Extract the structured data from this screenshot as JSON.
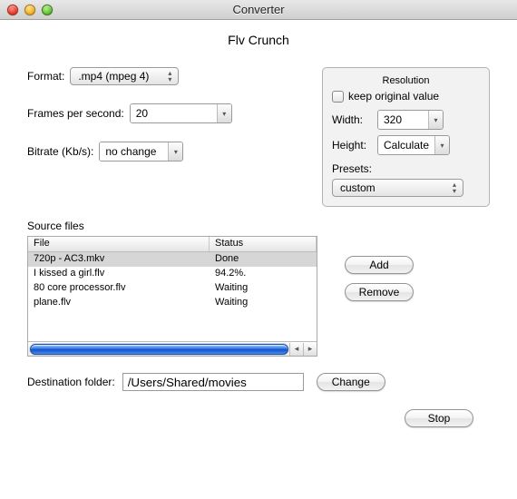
{
  "window": {
    "title": "Converter"
  },
  "app_title": "Flv Crunch",
  "labels": {
    "format": "Format:",
    "fps": "Frames per second:",
    "bitrate": "Bitrate (Kb/s):",
    "resolution_group": "Resolution",
    "keep_original": "keep original value",
    "width": "Width:",
    "height": "Height:",
    "presets": "Presets:",
    "source_files": "Source files",
    "file_col": "File",
    "status_col": "Status",
    "dest": "Destination folder:"
  },
  "values": {
    "format": ".mp4 (mpeg 4)",
    "fps": "20",
    "bitrate": "no change",
    "width": "320",
    "height": "Calculate",
    "preset": "custom",
    "dest_path": "/Users/Shared/movies"
  },
  "files": [
    {
      "name": "720p - AC3.mkv",
      "status": "Done",
      "selected": true
    },
    {
      "name": "I kissed a girl.flv",
      "status": "94.2%.",
      "selected": false
    },
    {
      "name": "80 core processor.flv",
      "status": "Waiting",
      "selected": false
    },
    {
      "name": "plane.flv",
      "status": "Waiting",
      "selected": false
    }
  ],
  "buttons": {
    "add": "Add",
    "remove": "Remove",
    "change": "Change",
    "stop": "Stop"
  }
}
